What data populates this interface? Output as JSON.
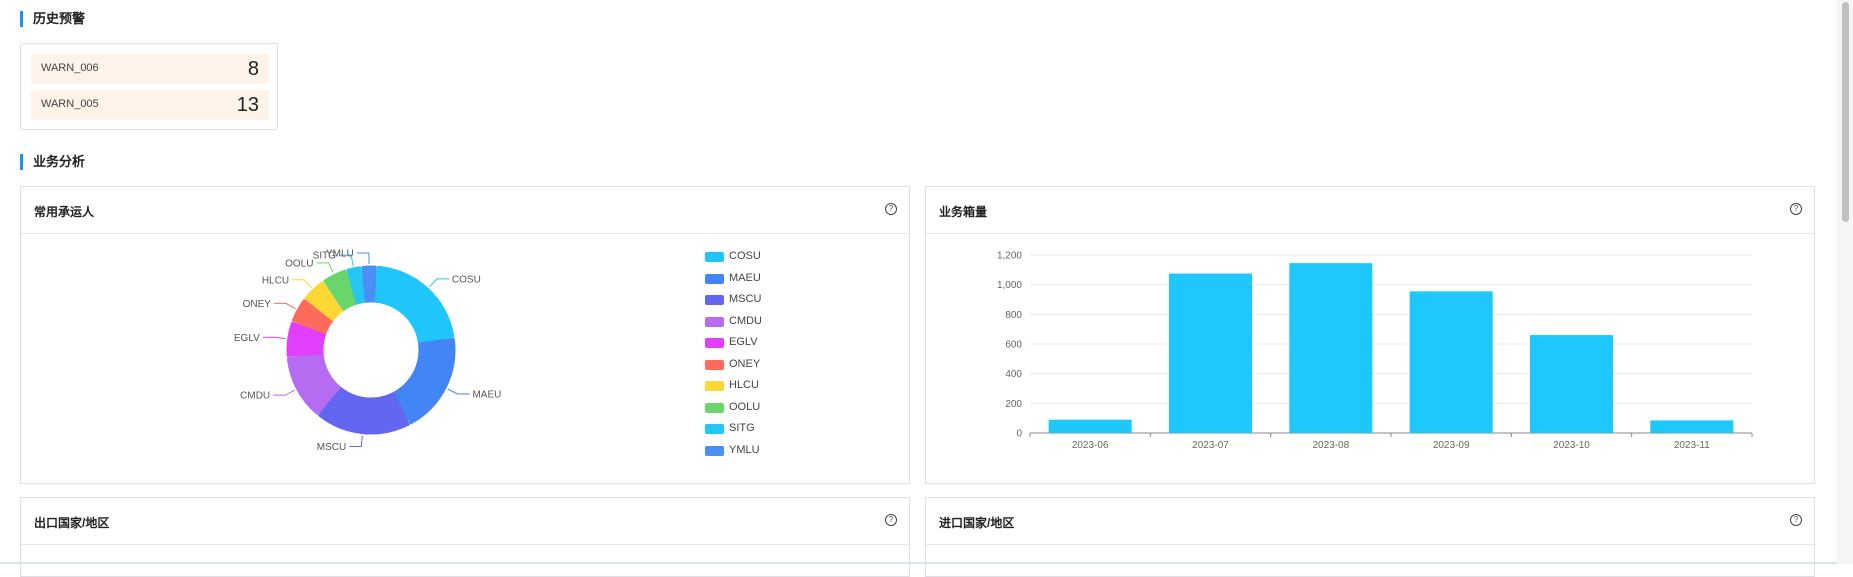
{
  "history": {
    "title": "历史预警",
    "items": [
      {
        "label": "WARN_006",
        "value": "8"
      },
      {
        "label": "WARN_005",
        "value": "13"
      }
    ]
  },
  "business": {
    "title": "业务分析",
    "panels": {
      "carriers": {
        "title": "常用承运人"
      },
      "volume": {
        "title": "业务箱量"
      },
      "export": {
        "title": "出口国家/地区"
      },
      "import": {
        "title": "进口国家/地区"
      }
    },
    "help_icon": "question-circle-icon"
  },
  "chart_data": [
    {
      "type": "pie",
      "categories": [
        "COSU",
        "MAEU",
        "MSCU",
        "CMDU",
        "EGLV",
        "ONEY",
        "HLCU",
        "OOLU",
        "SITG",
        "YMLU"
      ],
      "values": [
        22,
        20,
        19,
        13,
        7,
        5,
        5,
        5,
        3,
        3
      ],
      "colors": [
        "#1fc5fb",
        "#4285f4",
        "#6366f1",
        "#b56cf0",
        "#e040fb",
        "#ff6b5b",
        "#fdd835",
        "#6ad56a",
        "#26c6f2",
        "#4a8ff5"
      ],
      "legend_position": "right"
    },
    {
      "type": "bar",
      "categories": [
        "2023-06",
        "2023-07",
        "2023-08",
        "2023-09",
        "2023-10",
        "2023-11"
      ],
      "values": [
        90,
        1075,
        1145,
        955,
        660,
        85
      ],
      "ylim": [
        0,
        1200
      ],
      "yticks": [
        "0",
        "200",
        "400",
        "600",
        "800",
        "1,000",
        "1,200"
      ],
      "grid": true,
      "color": "#1fc8fc"
    }
  ]
}
